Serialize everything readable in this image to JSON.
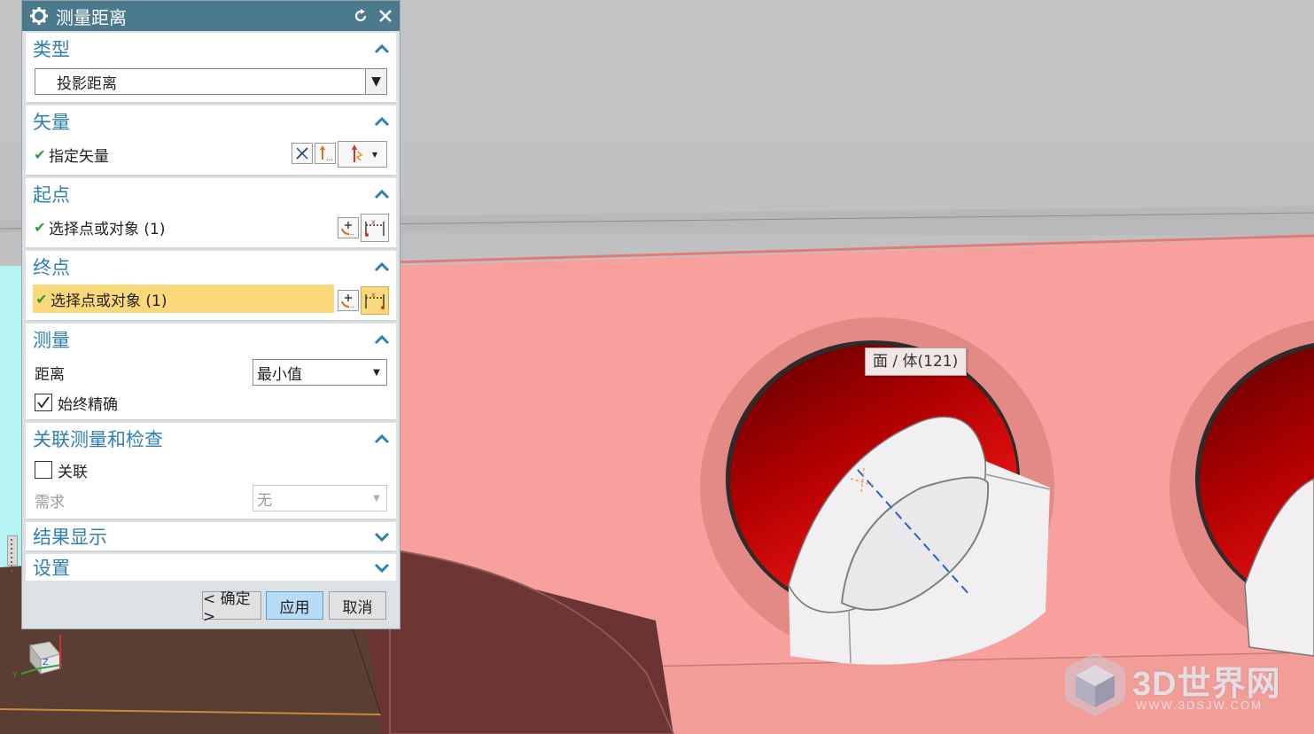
{
  "dialog": {
    "title": "测量距离",
    "reset_icon": "reset-icon",
    "close_icon": "close-icon",
    "sections": {
      "type": {
        "label": "类型",
        "selected": "投影距离"
      },
      "vector": {
        "label": "矢量",
        "row_label": "指定矢量"
      },
      "start": {
        "label": "起点",
        "row_label": "选择点或对象 (1)"
      },
      "end": {
        "label": "终点",
        "row_label": "选择点或对象 (1)"
      },
      "measure": {
        "label": "测量",
        "distance_label": "距离",
        "distance_value": "最小值",
        "always_accurate_label": "始终精确",
        "always_accurate_checked": true
      },
      "associative": {
        "label": "关联测量和检查",
        "associate_label": "关联",
        "associate_checked": false,
        "requirement_label": "需求",
        "requirement_value": "无"
      },
      "results": {
        "label": "结果显示"
      },
      "settings": {
        "label": "设置"
      }
    },
    "buttons": {
      "ok": "< 确定 >",
      "apply": "应用",
      "cancel": "取消"
    }
  },
  "viewport": {
    "tooltip": "面 / 体(121)"
  },
  "watermark": {
    "title": "3D世界网",
    "url": "WWW.3DSJW.COM"
  },
  "colors": {
    "accent": "#2f7fb3",
    "titlebar": "#4a7a8c",
    "highlight": "#fbd87a",
    "face": "#f8a09e"
  }
}
